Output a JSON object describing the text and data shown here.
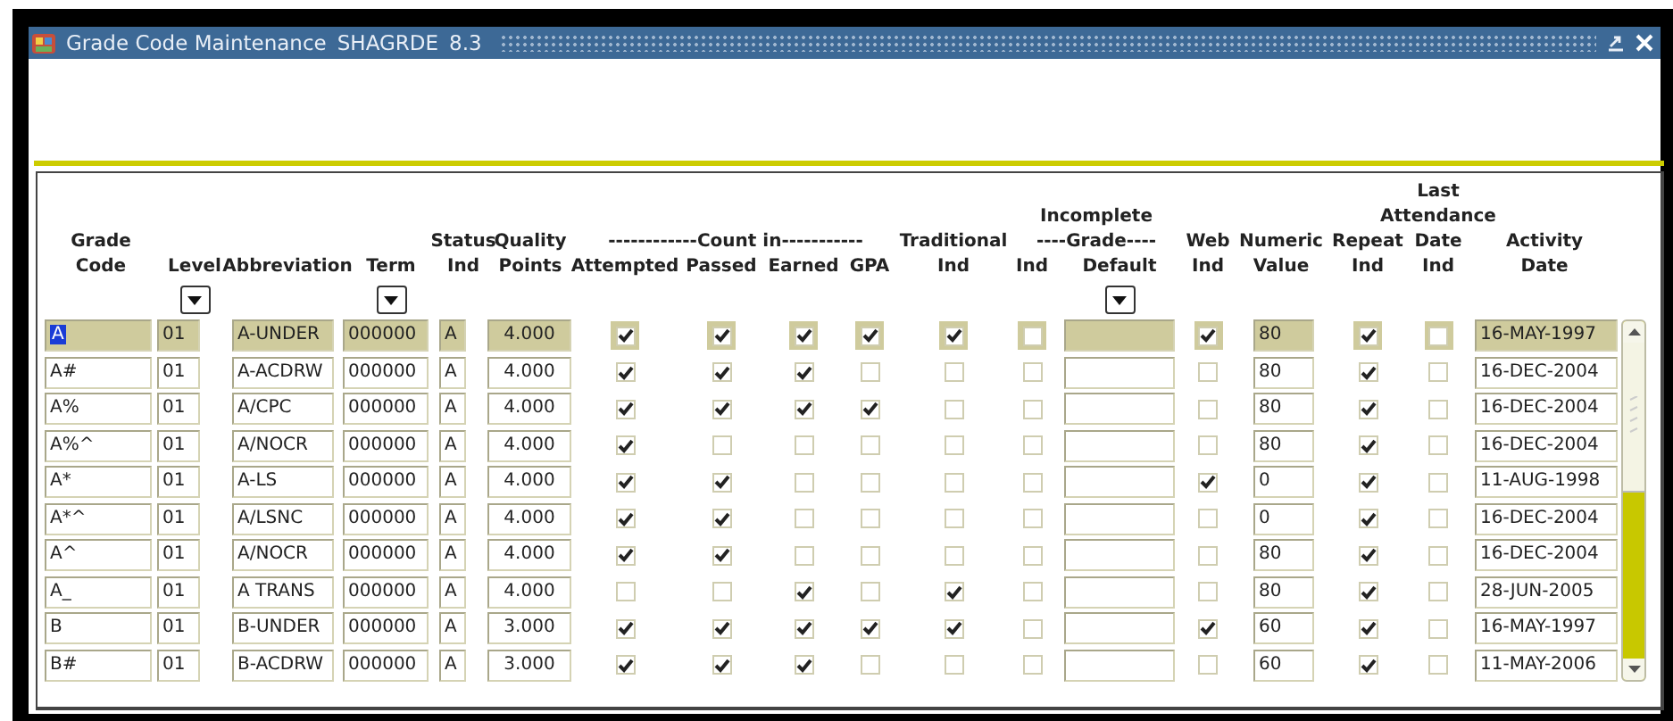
{
  "window": {
    "title": "Grade Code Maintenance",
    "form_code": "SHAGRDE",
    "version": "8.3"
  },
  "header": [
    {
      "kind": "column",
      "lines": [
        "Grade",
        "Code"
      ]
    },
    {
      "kind": "column",
      "lines": [
        "Level"
      ],
      "dropdown": true
    },
    {
      "kind": "column",
      "lines": [
        "Abbreviation"
      ]
    },
    {
      "kind": "column",
      "lines": [
        "Term"
      ],
      "dropdown": true
    },
    {
      "kind": "column",
      "lines": [
        "Status",
        "Ind"
      ]
    },
    {
      "kind": "column",
      "lines": [
        "Quality",
        "Points"
      ]
    },
    {
      "kind": "group",
      "lines": [
        "------------Count in-----------"
      ],
      "columns": [
        {
          "lines": [
            "Attempted"
          ]
        },
        {
          "lines": [
            "Passed"
          ]
        },
        {
          "lines": [
            "Earned"
          ]
        },
        {
          "lines": [
            "GPA"
          ]
        }
      ]
    },
    {
      "kind": "column",
      "lines": [
        "Traditional",
        "Ind"
      ]
    },
    {
      "kind": "group",
      "lines": [
        "Incomplete",
        "----Grade----"
      ],
      "columns": [
        {
          "lines": [
            "Ind"
          ]
        },
        {
          "lines": [
            "Default"
          ],
          "dropdown": true
        }
      ]
    },
    {
      "kind": "column",
      "lines": [
        "Web",
        "Ind"
      ]
    },
    {
      "kind": "column",
      "lines": [
        "Numeric",
        "Value"
      ]
    },
    {
      "kind": "column",
      "lines": [
        "Repeat",
        "Ind"
      ]
    },
    {
      "kind": "column",
      "lines": [
        "Last",
        "Attendance",
        "Date",
        "Ind"
      ]
    },
    {
      "kind": "column",
      "lines": [
        "Activity",
        "Date"
      ]
    }
  ],
  "rows": [
    {
      "selected": true,
      "code": "A",
      "level": "01",
      "abbreviation": "A-UNDER",
      "term": "000000",
      "status": "A",
      "points": "4.000",
      "attempted": true,
      "passed": true,
      "earned": true,
      "gpa": true,
      "traditional": true,
      "incomplete_ind": false,
      "web": true,
      "numeric": "80",
      "repeat": true,
      "last_attendance": false,
      "activity_date": "16-MAY-1997"
    },
    {
      "selected": false,
      "code": "A#",
      "level": "01",
      "abbreviation": "A-ACDRW",
      "term": "000000",
      "status": "A",
      "points": "4.000",
      "attempted": true,
      "passed": true,
      "earned": true,
      "gpa": false,
      "traditional": false,
      "incomplete_ind": false,
      "web": false,
      "numeric": "80",
      "repeat": true,
      "last_attendance": false,
      "activity_date": "16-DEC-2004"
    },
    {
      "selected": false,
      "code": "A%",
      "level": "01",
      "abbreviation": "A/CPC",
      "term": "000000",
      "status": "A",
      "points": "4.000",
      "attempted": true,
      "passed": true,
      "earned": true,
      "gpa": true,
      "traditional": false,
      "incomplete_ind": false,
      "web": false,
      "numeric": "80",
      "repeat": true,
      "last_attendance": false,
      "activity_date": "16-DEC-2004"
    },
    {
      "selected": false,
      "code": "A%^",
      "level": "01",
      "abbreviation": "A/NOCR",
      "term": "000000",
      "status": "A",
      "points": "4.000",
      "attempted": true,
      "passed": false,
      "earned": false,
      "gpa": false,
      "traditional": false,
      "incomplete_ind": false,
      "web": false,
      "numeric": "80",
      "repeat": true,
      "last_attendance": false,
      "activity_date": "16-DEC-2004"
    },
    {
      "selected": false,
      "code": "A*",
      "level": "01",
      "abbreviation": "A-LS",
      "term": "000000",
      "status": "A",
      "points": "4.000",
      "attempted": true,
      "passed": true,
      "earned": false,
      "gpa": false,
      "traditional": false,
      "incomplete_ind": false,
      "web": true,
      "numeric": "0",
      "repeat": true,
      "last_attendance": false,
      "activity_date": "11-AUG-1998"
    },
    {
      "selected": false,
      "code": "A*^",
      "level": "01",
      "abbreviation": "A/LSNC",
      "term": "000000",
      "status": "A",
      "points": "4.000",
      "attempted": true,
      "passed": true,
      "earned": false,
      "gpa": false,
      "traditional": false,
      "incomplete_ind": false,
      "web": false,
      "numeric": "0",
      "repeat": true,
      "last_attendance": false,
      "activity_date": "16-DEC-2004"
    },
    {
      "selected": false,
      "code": "A^",
      "level": "01",
      "abbreviation": "A/NOCR",
      "term": "000000",
      "status": "A",
      "points": "4.000",
      "attempted": true,
      "passed": true,
      "earned": false,
      "gpa": false,
      "traditional": false,
      "incomplete_ind": false,
      "web": false,
      "numeric": "80",
      "repeat": true,
      "last_attendance": false,
      "activity_date": "16-DEC-2004"
    },
    {
      "selected": false,
      "code": "A_",
      "level": "01",
      "abbreviation": "A TRANS",
      "term": "000000",
      "status": "A",
      "points": "4.000",
      "attempted": false,
      "passed": false,
      "earned": true,
      "gpa": false,
      "traditional": true,
      "incomplete_ind": false,
      "web": false,
      "numeric": "80",
      "repeat": true,
      "last_attendance": false,
      "activity_date": "28-JUN-2005"
    },
    {
      "selected": false,
      "code": "B",
      "level": "01",
      "abbreviation": "B-UNDER",
      "term": "000000",
      "status": "A",
      "points": "3.000",
      "attempted": true,
      "passed": true,
      "earned": true,
      "gpa": true,
      "traditional": true,
      "incomplete_ind": false,
      "web": true,
      "numeric": "60",
      "repeat": true,
      "last_attendance": false,
      "activity_date": "16-MAY-1997"
    },
    {
      "selected": false,
      "code": "B#",
      "level": "01",
      "abbreviation": "B-ACDRW",
      "term": "000000",
      "status": "A",
      "points": "3.000",
      "attempted": true,
      "passed": true,
      "earned": true,
      "gpa": false,
      "traditional": false,
      "incomplete_ind": false,
      "web": false,
      "numeric": "60",
      "repeat": true,
      "last_attendance": false,
      "activity_date": "11-MAY-2006"
    }
  ]
}
